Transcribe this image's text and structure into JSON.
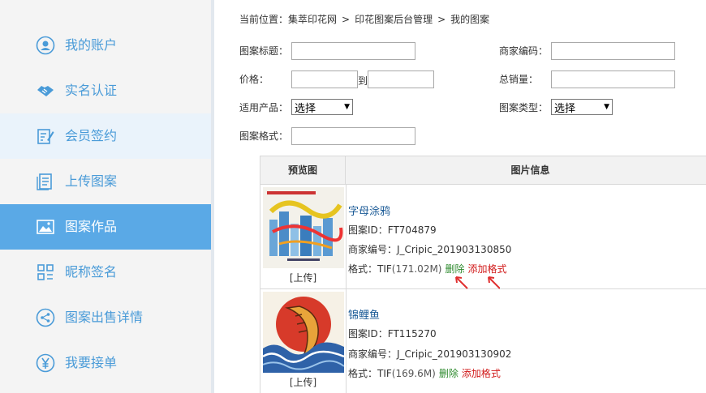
{
  "sidebar": {
    "items": [
      {
        "label": "我的账户",
        "icon": "user-icon"
      },
      {
        "label": "实名认证",
        "icon": "handshake-icon"
      },
      {
        "label": "会员签约",
        "icon": "sign-icon"
      },
      {
        "label": "上传图案",
        "icon": "upload-doc-icon"
      },
      {
        "label": "图案作品",
        "icon": "image-icon"
      },
      {
        "label": "昵称签名",
        "icon": "grid-icon"
      },
      {
        "label": "图案出售详情",
        "icon": "share-icon"
      },
      {
        "label": "我要接单",
        "icon": "yen-icon"
      }
    ],
    "active_index": 4
  },
  "breadcrumb": {
    "prefix": "当前位置：",
    "items": [
      "集萃印花网",
      "印花图案后台管理",
      "我的图案"
    ],
    "separator": ">"
  },
  "filters": {
    "title_label": "图案标题：",
    "merchant_code_label": "商家编码：",
    "price_label": "价格：",
    "price_to": "到",
    "sales_label": "总销量：",
    "product_label": "适用产品：",
    "product_value": "选择",
    "type_label": "图案类型：",
    "type_value": "选择",
    "format_label": "图案格式："
  },
  "table": {
    "headers": {
      "preview": "预览图",
      "info": "图片信息"
    },
    "rows": [
      {
        "upload": "[上传]",
        "title": "字母涂鸦",
        "id_line": "图案ID：FT704879",
        "code_line": "商家编号：J_Cripic_201903130850",
        "format_prefix": "格式：TIF",
        "format_size": "(171.02M)",
        "delete": "删除",
        "add_format": "添加格式"
      },
      {
        "upload": "[上传]",
        "title": "锦鲤鱼",
        "id_line": "图案ID：FT115270",
        "code_line": "商家编号：J_Cripic_201903130902",
        "format_prefix": "格式：TIF",
        "format_size": "(169.6M)",
        "delete": "删除",
        "add_format": "添加格式"
      }
    ]
  },
  "colors": {
    "accent": "#4a9bd8",
    "active_bg": "#5aa9e6",
    "delete": "#2e8b2e",
    "add_format": "#d11a1a",
    "annotation_arrow": "#e03030"
  }
}
